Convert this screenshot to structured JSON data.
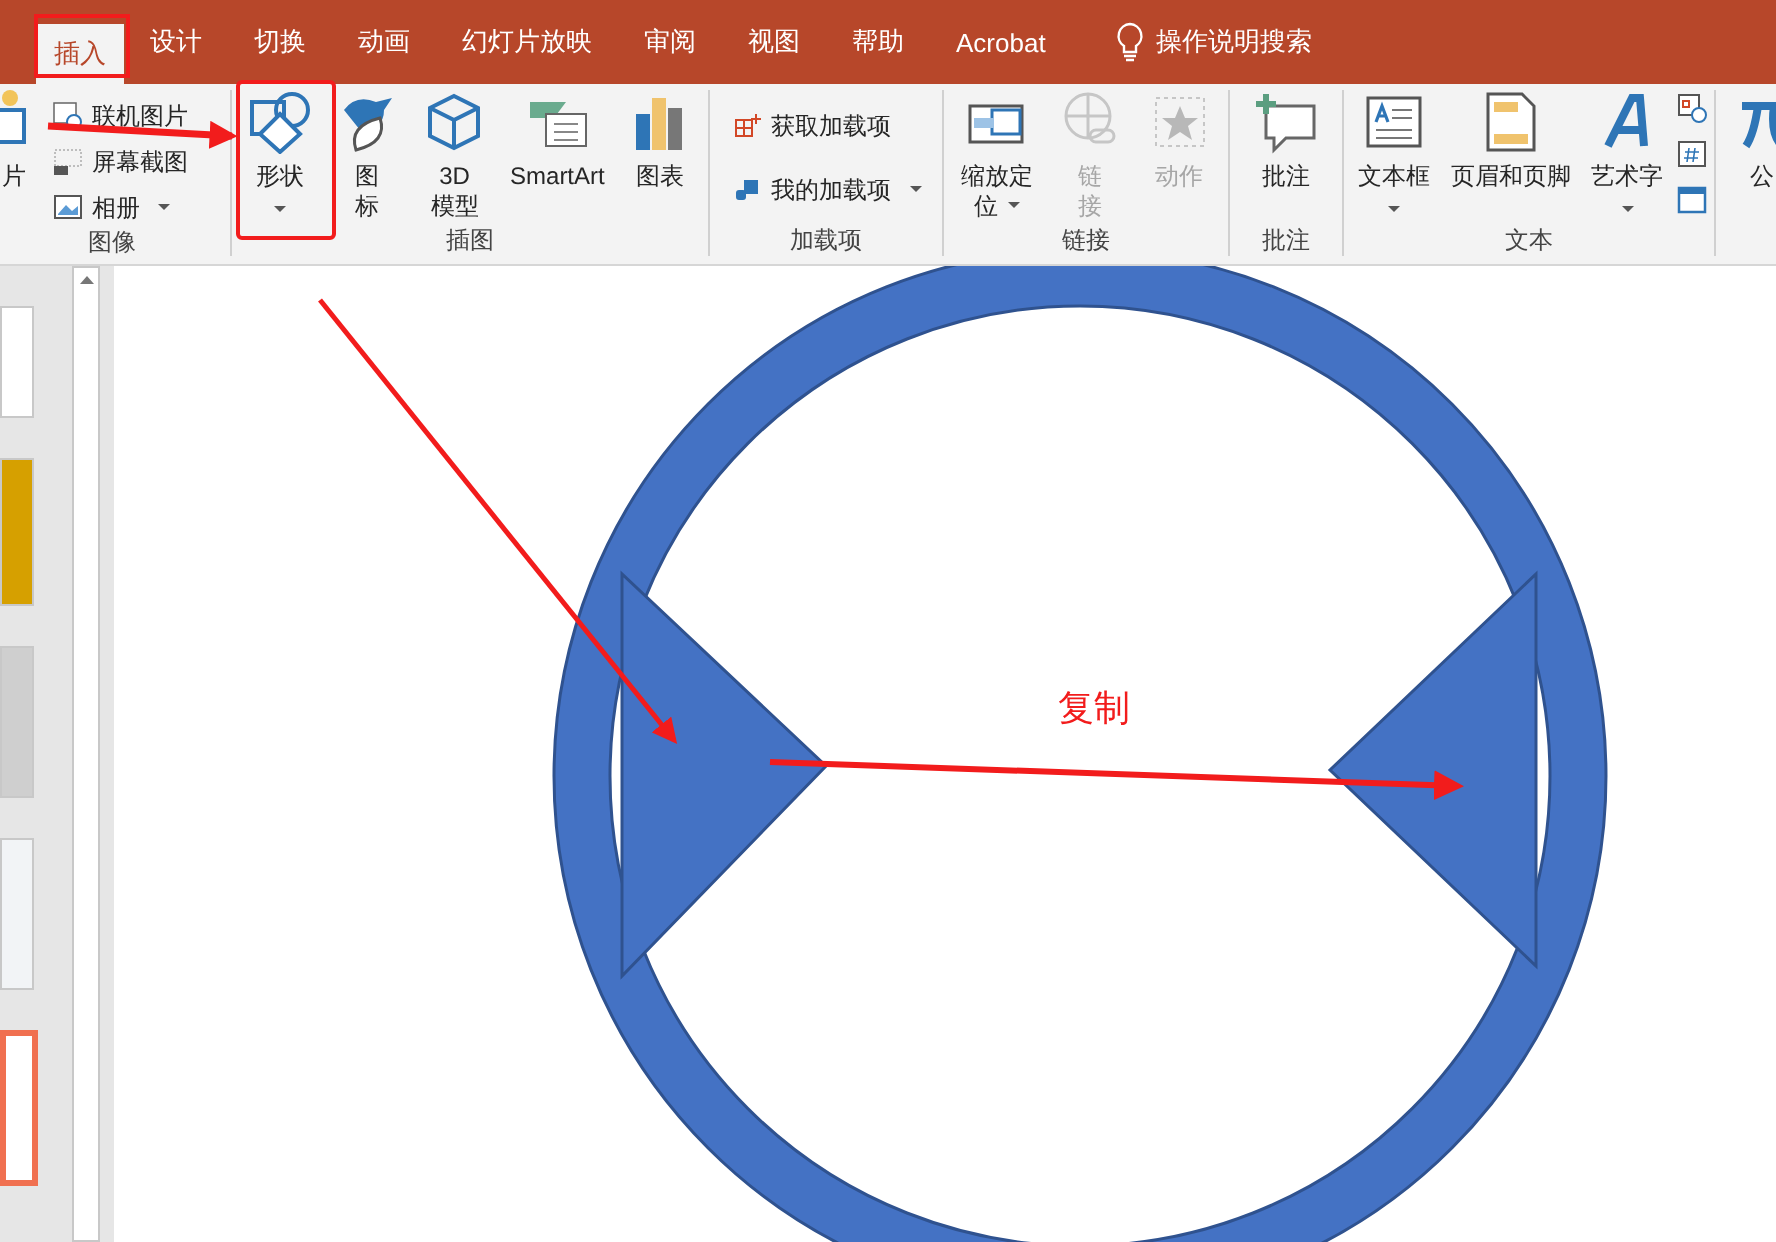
{
  "tabs": [
    {
      "label": "插入",
      "selected": true
    },
    {
      "label": "设计",
      "selected": false
    },
    {
      "label": "切换",
      "selected": false
    },
    {
      "label": "动画",
      "selected": false
    },
    {
      "label": "幻灯片放映",
      "selected": false
    },
    {
      "label": "审阅",
      "selected": false
    },
    {
      "label": "视图",
      "selected": false
    },
    {
      "label": "帮助",
      "selected": false
    },
    {
      "label": "Acrobat",
      "selected": false
    }
  ],
  "search": {
    "label": "操作说明搜索"
  },
  "ribbon": {
    "groups": [
      {
        "label": "图像",
        "items": [
          {
            "kind": "large",
            "lines": [
              "片"
            ],
            "disabled": false
          },
          {
            "kind": "small",
            "label": "联机图片",
            "disabled": false
          },
          {
            "kind": "small",
            "label": "屏幕截图",
            "disabled": false
          },
          {
            "kind": "small",
            "label": "相册",
            "dropdown": true,
            "disabled": false
          }
        ]
      },
      {
        "label": "插图",
        "items": [
          {
            "kind": "large",
            "lines": [
              "形状"
            ],
            "dropdown": true,
            "disabled": false
          },
          {
            "kind": "large",
            "lines": [
              "图",
              "标"
            ],
            "disabled": false
          },
          {
            "kind": "large",
            "lines": [
              "3D",
              "模型"
            ],
            "disabled": false
          },
          {
            "kind": "large",
            "lines": [
              "SmartArt"
            ],
            "disabled": false
          },
          {
            "kind": "large",
            "lines": [
              "图表"
            ],
            "disabled": false
          }
        ]
      },
      {
        "label": "加载项",
        "items": [
          {
            "kind": "small",
            "label": "获取加载项",
            "disabled": false
          },
          {
            "kind": "small",
            "label": "我的加载项",
            "dropdown": true,
            "disabled": false
          }
        ]
      },
      {
        "label": "链接",
        "items": [
          {
            "kind": "large",
            "lines": [
              "缩放定",
              "位"
            ],
            "dropdown": true,
            "disabled": false
          },
          {
            "kind": "large",
            "lines": [
              "链",
              "接"
            ],
            "disabled": true
          },
          {
            "kind": "large",
            "lines": [
              "动作"
            ],
            "disabled": true
          }
        ]
      },
      {
        "label": "批注",
        "items": [
          {
            "kind": "large",
            "lines": [
              "批注"
            ],
            "disabled": false
          }
        ]
      },
      {
        "label": "文本",
        "items": [
          {
            "kind": "large",
            "lines": [
              "文本框"
            ],
            "dropdown": true,
            "disabled": false
          },
          {
            "kind": "large",
            "lines": [
              "页眉和页脚"
            ],
            "disabled": false
          },
          {
            "kind": "large",
            "lines": [
              "艺术字"
            ],
            "dropdown": true,
            "disabled": false
          },
          {
            "kind": "tiny",
            "disabled": false
          },
          {
            "kind": "tiny",
            "disabled": false
          },
          {
            "kind": "tiny",
            "disabled": false
          }
        ]
      },
      {
        "items": [
          {
            "kind": "large",
            "lines": [
              "公"
            ],
            "disabled": false
          }
        ]
      }
    ]
  },
  "thumbnails": [
    {
      "selected": false
    },
    {
      "selected": false
    },
    {
      "selected": false
    },
    {
      "selected": false
    },
    {
      "selected": true
    }
  ],
  "slide": {
    "annotation": "复制"
  }
}
